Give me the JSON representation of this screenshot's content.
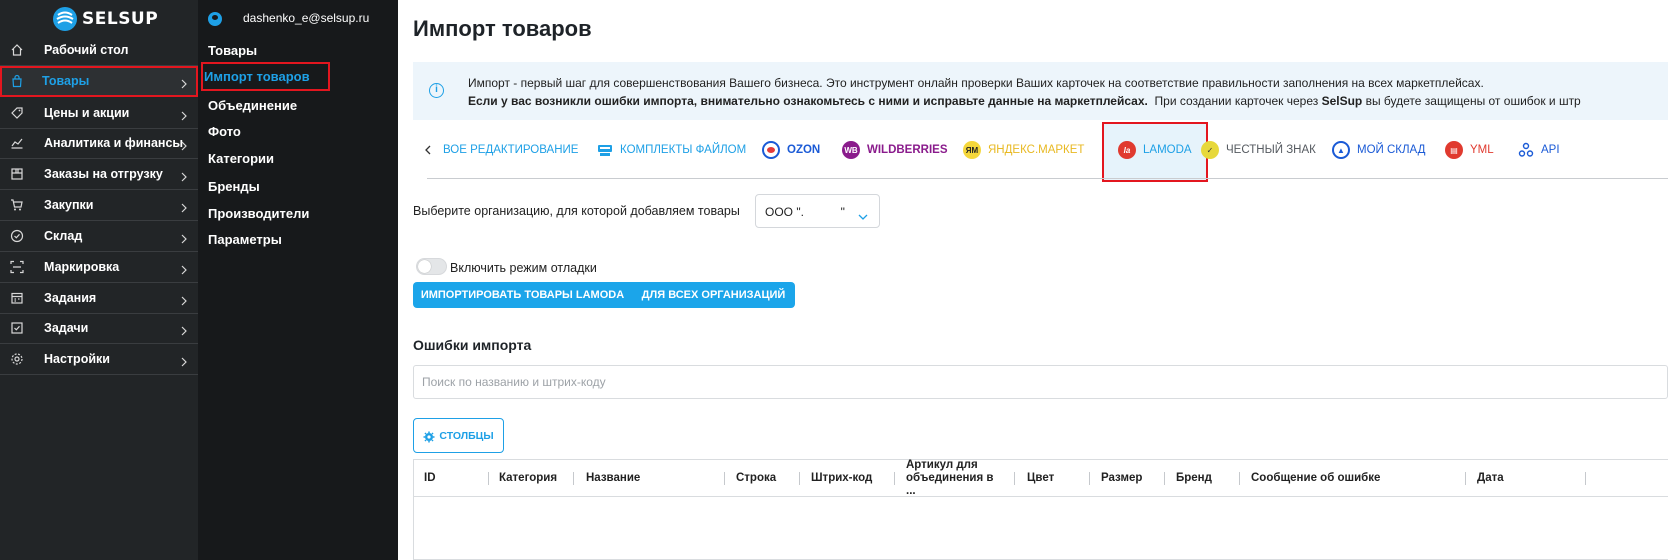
{
  "app": {
    "brand": "SELSUP",
    "user_email": "dashenko_e@selsup.ru",
    "accent": "#1ea0e6",
    "highlight": "#e3161f"
  },
  "sidebar": {
    "items": [
      {
        "label": "Рабочий стол",
        "icon": "home-icon"
      },
      {
        "label": "Товары",
        "icon": "bag-icon",
        "active": true
      },
      {
        "label": "Цены и акции",
        "icon": "tag-icon"
      },
      {
        "label": "Аналитика и финансы",
        "icon": "chart-icon"
      },
      {
        "label": "Заказы на отгрузку",
        "icon": "box-icon"
      },
      {
        "label": "Закупки",
        "icon": "cart-icon"
      },
      {
        "label": "Склад",
        "icon": "check-circle-icon"
      },
      {
        "label": "Маркировка",
        "icon": "barcode-icon"
      },
      {
        "label": "Задания",
        "icon": "calendar-icon"
      },
      {
        "label": "Задачи",
        "icon": "checkbox-icon"
      },
      {
        "label": "Настройки",
        "icon": "gear-icon"
      }
    ]
  },
  "submenu": {
    "items": [
      {
        "label": "Товары"
      },
      {
        "label": "Импорт товаров",
        "active": true
      },
      {
        "label": "Объединение"
      },
      {
        "label": "Фото"
      },
      {
        "label": "Категории"
      },
      {
        "label": "Бренды"
      },
      {
        "label": "Производители"
      },
      {
        "label": "Параметры"
      }
    ]
  },
  "main": {
    "title": "Импорт товаров",
    "info": {
      "line1": "Импорт - первый шаг для совершенствования Вашего бизнеса. Это инструмент онлайн проверки Ваших карточек на соответствие правильности заполнения на всех маркетплейсах.",
      "line2_bold": "Если у вас возникли ошибки импорта, внимательно ознакомьтесь с ними и исправьте данные на маркетплейсах.",
      "line2_rest_pre": "  При создании карточек через ",
      "line2_brand": "SelSup",
      "line2_rest_post": " вы будете защищены от ошибок и штр"
    },
    "tabs": [
      {
        "label": "ВОЕ РЕДАКТИРОВАНИЕ",
        "color": "#1ea0e6",
        "icon": ""
      },
      {
        "label": "КОМПЛЕКТЫ ФАЙЛОМ",
        "color": "#1ea0e6",
        "icon": "file-set-icon"
      },
      {
        "label": "OZON",
        "color": "#1a5ad6",
        "icon": "ozon-icon",
        "bold": true
      },
      {
        "label": "WILDBERRIES",
        "color": "#8a1b8c",
        "icon": "wildberries-icon",
        "bold": true
      },
      {
        "label": "ЯНДЕКС.МАРКЕТ",
        "color": "#e8b923",
        "icon": "yandex-market-icon"
      },
      {
        "label": "LAMODA",
        "color": "#1ea0e6",
        "icon": "lamoda-icon",
        "active": true
      },
      {
        "label": "ЧЕСТНЫЙ ЗНАК",
        "color": "#555a60",
        "icon": "chestny-znak-icon"
      },
      {
        "label": "МОЙ СКЛАД",
        "color": "#1a5ad6",
        "icon": "moy-sklad-icon"
      },
      {
        "label": "YML",
        "color": "#e03a2f",
        "icon": "yml-icon"
      },
      {
        "label": "API",
        "color": "#1a5ad6",
        "icon": "api-icon"
      }
    ],
    "org": {
      "label": "Выберите организацию, для которой добавляем товары",
      "value": "ООО \".           \""
    },
    "debug_label": "Включить режим отладки",
    "import_button": "ИМПОРТИРОВАТЬ ТОВАРЫ LAMODA",
    "import_all_button": "ДЛЯ ВСЕХ ОРГАНИЗАЦИЙ",
    "errors_title": "Ошибки импорта",
    "search_placeholder": "Поиск по названию и штрих-коду",
    "columns_button": "СТОЛБЦЫ",
    "table_columns": [
      "ID",
      "Категория",
      "Название",
      "Строка",
      "Штрих-код",
      "Артикул для объединения в ...",
      "Цвет",
      "Размер",
      "Бренд",
      "Сообщение об ошибке",
      "Дата"
    ]
  }
}
